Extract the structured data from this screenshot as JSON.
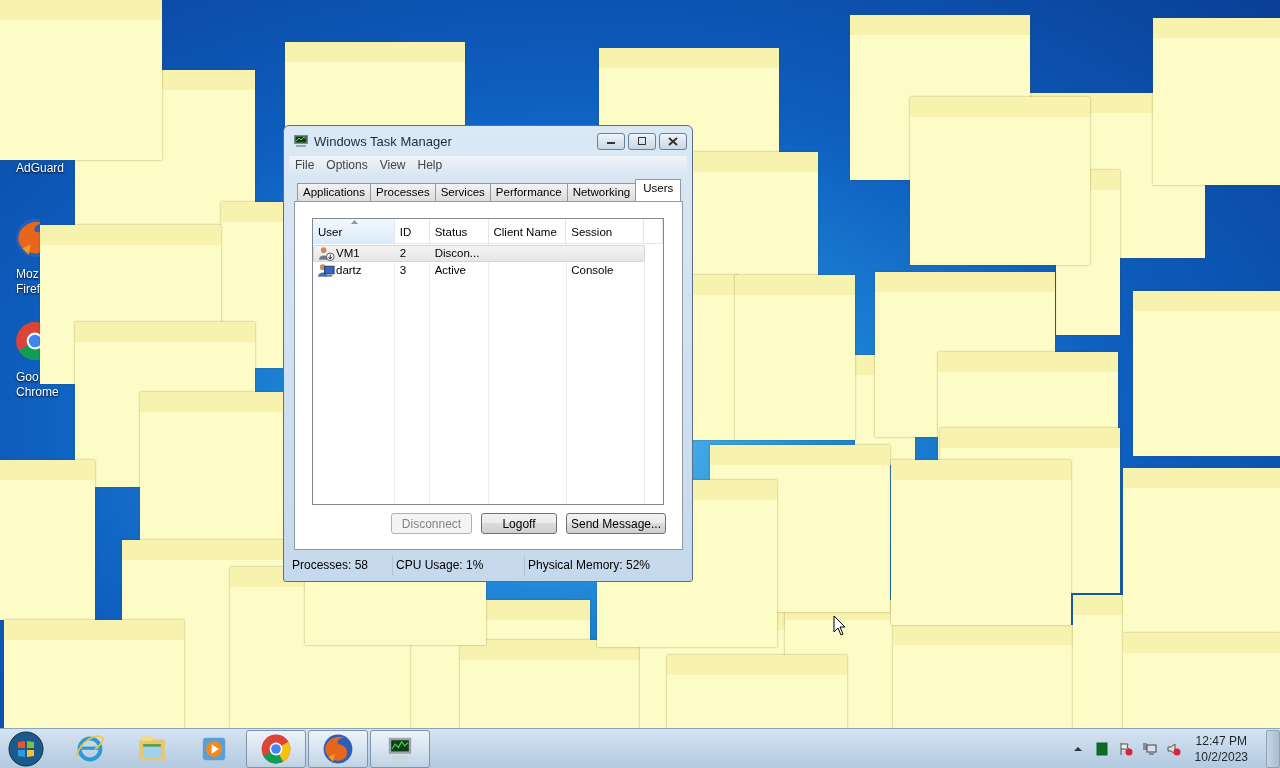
{
  "desktop_icons": [
    {
      "kind": "none",
      "lines": [
        "AdGuard"
      ]
    },
    {
      "kind": "firefox",
      "lines": [
        "Moz",
        "Firef"
      ]
    },
    {
      "kind": "chrome",
      "lines": [
        "Goo",
        "Chrome"
      ]
    }
  ],
  "window": {
    "title": "Windows Task Manager",
    "menu": [
      "File",
      "Options",
      "View",
      "Help"
    ],
    "tabs": [
      {
        "label": "Applications",
        "selected": false
      },
      {
        "label": "Processes",
        "selected": false
      },
      {
        "label": "Services",
        "selected": false
      },
      {
        "label": "Performance",
        "selected": false
      },
      {
        "label": "Networking",
        "selected": false
      },
      {
        "label": "Users",
        "selected": true
      }
    ],
    "columns": [
      {
        "label": "User",
        "sorted": true
      },
      {
        "label": "ID",
        "sorted": false
      },
      {
        "label": "Status",
        "sorted": false
      },
      {
        "label": "Client Name",
        "sorted": false
      },
      {
        "label": "Session",
        "sorted": false
      }
    ],
    "rows": [
      {
        "kind": "disconnected",
        "selected": true,
        "user": "VM1",
        "id": "2",
        "status": "Discon..."
      },
      {
        "kind": "active",
        "selected": false,
        "user": "dartz",
        "id": "3",
        "status": "Active",
        "session": "Console"
      }
    ],
    "buttons": [
      {
        "label": "Disconnect",
        "disabled": true
      },
      {
        "label": "Logoff",
        "disabled": false
      },
      {
        "label": "Send Message...",
        "disabled": false
      }
    ],
    "status_bar": [
      "Processes: 58",
      "CPU Usage: 1%",
      "Physical Memory: 52%"
    ]
  },
  "taskbar": {
    "items": [
      {
        "kind": "ie",
        "running": false
      },
      {
        "kind": "explorer",
        "running": false
      },
      {
        "kind": "media",
        "running": false
      },
      {
        "kind": "chrome",
        "running": true
      },
      {
        "kind": "firefox",
        "running": true
      },
      {
        "kind": "taskmgr",
        "running": true
      }
    ],
    "clock": {
      "time": "12:47 PM",
      "date": "10/2/2023"
    }
  }
}
